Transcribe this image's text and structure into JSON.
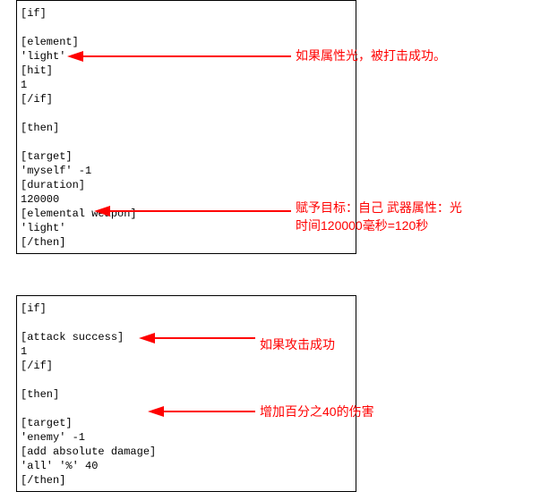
{
  "code": {
    "block1": "[if]\n\n[element]\n'light'\n[hit]\n1\n[/if]\n\n[then]\n\n[target]\n'myself' -1\n[duration]\n120000\n[elemental weapon]\n'light'\n[/then]",
    "block2": "[if]\n\n[attack success]\n1\n[/if]\n\n[then]\n\n[target]\n'enemy' -1\n[add absolute damage]\n'all' '%' 40\n[/then]",
    "block3": ""
  },
  "annotations": {
    "a1": "如果属性光，被打击成功。",
    "a2_l1": "赋予目标：自己 武器属性：光",
    "a2_l2": "时间120000毫秒=120秒",
    "a3": "如果攻击成功",
    "a4": "增加百分之40的伤害"
  }
}
